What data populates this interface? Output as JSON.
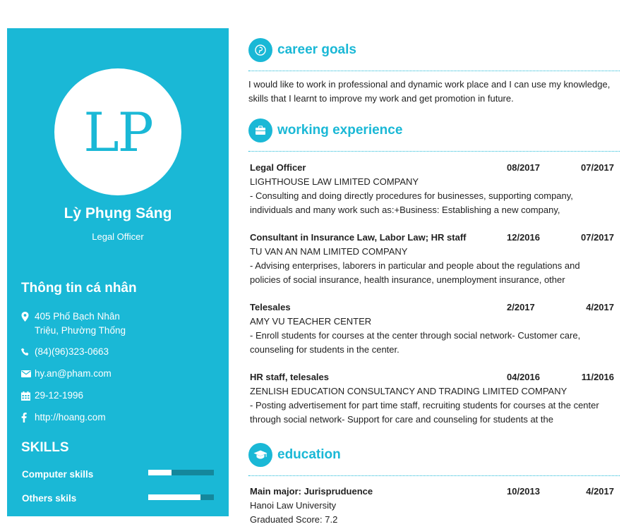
{
  "profile": {
    "initials": "LP",
    "name": "Lỳ Phụng Sáng",
    "role": "Legal Officer"
  },
  "personal": {
    "heading": "Thông tin cá nhân",
    "address": "405 Phố Bạch Nhân Triệu, Phường Thống",
    "phone": "(84)(96)323-0663",
    "email": "hy.an@pham.com",
    "birthday": "29-12-1996",
    "website": "http://hoang.com"
  },
  "skills": {
    "heading": "SKILLS",
    "items": [
      {
        "label": "Computer skills",
        "level": 0.35
      },
      {
        "label": "Others skils",
        "level": 0.8
      }
    ]
  },
  "career": {
    "heading": "career goals",
    "text": "I would like to work in professional and dynamic work place and I can use my knowledge, skills that I learnt to improve my work and get promotion in future."
  },
  "experience": {
    "heading": "working experience",
    "jobs": [
      {
        "title": "Legal Officer",
        "from": "08/2017",
        "to": "07/2017",
        "company": "LIGHTHOUSE LAW LIMITED COMPANY",
        "desc": "- Consulting and doing directly procedures for businesses, supporting company, individuals and many work such as:+Business: Establishing a new company,"
      },
      {
        "title": "Consultant in Insurance Law, Labor Law; HR staff",
        "from": "12/2016",
        "to": "07/2017",
        "company": "TU VAN AN NAM LIMITED COMPANY",
        "desc": "- Advising enterprises, laborers in particular and people about the regulations and policies of social insurance, health insurance, unemployment insurance, other"
      },
      {
        "title": "Telesales",
        "from": "2/2017",
        "to": "4/2017",
        "company": "AMY VU TEACHER CENTER",
        "desc": "- Enroll students for courses at the center through social network- Customer care, counseling for students in the center."
      },
      {
        "title": "HR staff, telesales",
        "from": "04/2016",
        "to": "11/2016",
        "company": "ZENLISH EDUCATION CONSULTANCY AND TRADING LIMITED COMPANY",
        "desc": "- Posting advertisement for part time staff, recruiting students for courses at the center through social network- Support for care and counseling for students at the"
      }
    ]
  },
  "education": {
    "heading": "education",
    "major": "Main major: Jurispruduence",
    "from": "10/2013",
    "to": "4/2017",
    "school": "Hanoi Law University",
    "score": "Graduated Score: 7.2"
  },
  "colors": {
    "accent": "#1ab8d6",
    "bar_track": "#14879c"
  },
  "icons": [
    "map-marker-icon",
    "phone-icon",
    "envelope-icon",
    "calendar-icon",
    "facebook-icon",
    "pinterest-icon",
    "briefcase-icon",
    "graduation-cap-icon"
  ]
}
